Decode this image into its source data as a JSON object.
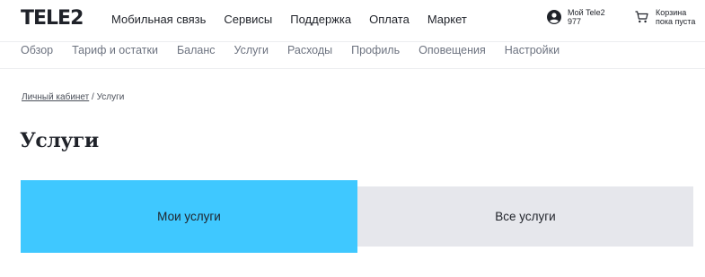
{
  "header": {
    "logo": "TELE2",
    "nav": [
      "Мобильная связь",
      "Сервисы",
      "Поддержка",
      "Оплата",
      "Маркет"
    ],
    "account": {
      "title": "Мой Tele2",
      "number": "977",
      "icon": "user-circle-icon"
    },
    "cart": {
      "title": "Корзина",
      "status": "пока пуста",
      "icon": "cart-icon"
    }
  },
  "subnav": [
    "Обзор",
    "Тариф и остатки",
    "Баланс",
    "Услуги",
    "Расходы",
    "Профиль",
    "Оповещения",
    "Настройки"
  ],
  "breadcrumb": {
    "link": "Личный кабинет",
    "separator": " / ",
    "current": "Услуги"
  },
  "page_title": "Услуги",
  "tabs": [
    {
      "label": "Мои услуги",
      "active": true
    },
    {
      "label": "Все услуги",
      "active": false
    }
  ],
  "colors": {
    "accent": "#3fc8ff",
    "inactive_tab": "#e6e7ec",
    "text": "#1f2229"
  }
}
